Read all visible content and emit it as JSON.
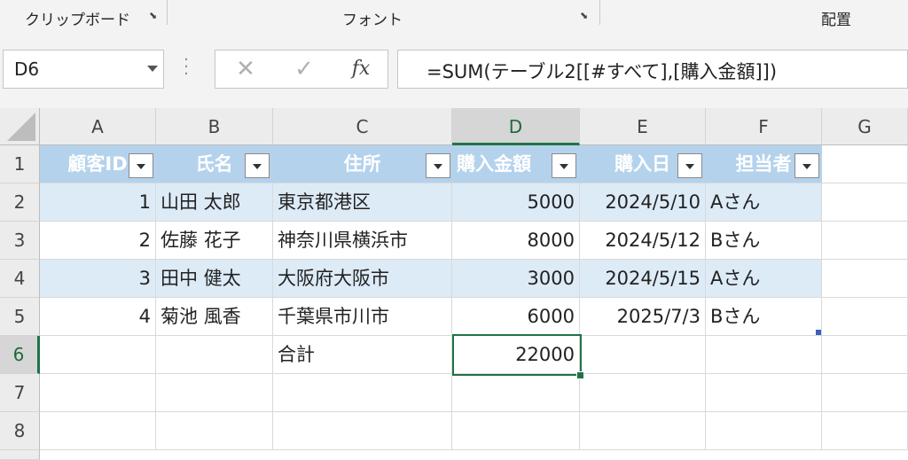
{
  "ribbon": {
    "groups": [
      {
        "label": "クリップボード"
      },
      {
        "label": "フォント"
      },
      {
        "label": "配置"
      }
    ]
  },
  "formula_bar": {
    "name_box": "D6",
    "cancel_icon": "✕",
    "enter_icon": "✓",
    "fx_label": "fx",
    "formula": "=SUM(テーブル2[[#すべて],[購入金額]])"
  },
  "columns": [
    "A",
    "B",
    "C",
    "D",
    "E",
    "F",
    "G"
  ],
  "rows": [
    "1",
    "2",
    "3",
    "4",
    "5",
    "6",
    "7",
    "8"
  ],
  "selected_cell": "D6",
  "table": {
    "headers": [
      "顧客ID",
      "氏名",
      "住所",
      "購入金額",
      "購入日",
      "担当者"
    ],
    "rows": [
      [
        "1",
        "山田 太郎",
        "東京都港区",
        "5000",
        "2024/5/10",
        "Aさん"
      ],
      [
        "2",
        "佐藤 花子",
        "神奈川県横浜市",
        "8000",
        "2024/5/12",
        "Bさん"
      ],
      [
        "3",
        "田中 健太",
        "大阪府大阪市",
        "3000",
        "2024/5/15",
        "Aさん"
      ],
      [
        "4",
        "菊池 風香",
        "千葉県市川市",
        "6000",
        "2025/7/3",
        "Bさん"
      ]
    ],
    "total_label": "合計",
    "total_value": "22000"
  },
  "colors": {
    "header_fill": "#b4d2ec",
    "band_fill": "#ddebf7",
    "selection_green": "#217346"
  }
}
